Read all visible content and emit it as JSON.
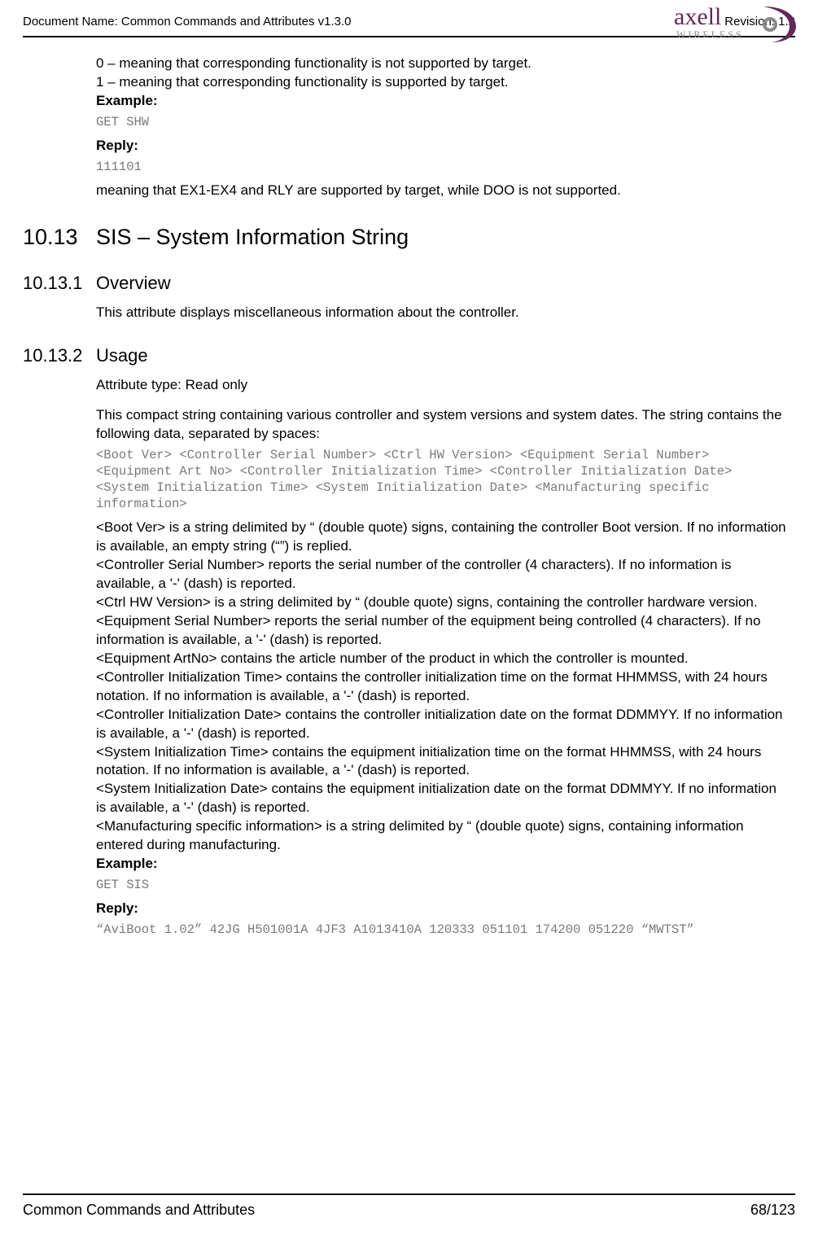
{
  "header": {
    "doc_name_label": "Document Name: Common Commands and Attributes v1.3.0",
    "revision_label": "Revision: 1.2",
    "logo_text_main": "axell",
    "logo_text_sub": "WIRELESS"
  },
  "intro": {
    "line0": "0 – meaning that corresponding functionality is not supported by target.",
    "line1": "1 – meaning that corresponding functionality is supported by target.",
    "example_hdr": "Example:",
    "example_code": "GET SHW",
    "reply_hdr": "Reply:",
    "reply_code": "111101",
    "meaning": "meaning that EX1-EX4 and RLY are supported by target, while DOO is not supported."
  },
  "s1013": {
    "num": "10.13",
    "title": "SIS – System Information String"
  },
  "s10131": {
    "num": "10.13.1",
    "title": "Overview",
    "body": "This attribute displays miscellaneous information about the controller."
  },
  "s10132": {
    "num": "10.13.2",
    "title": "Usage",
    "attr_type": "Attribute type: Read only",
    "intro": "This compact string containing various controller and system versions and system dates. The string contains the following data, separated by spaces:",
    "format": "<Boot Ver> <Controller Serial Number> <Ctrl HW Version> <Equipment Serial Number> <Equipment Art No> <Controller Initialization Time> <Controller Initialization Date> <System Initialization Time> <System Initialization Date>  <Manufacturing specific information>",
    "p_boot": "<Boot Ver> is a string delimited by “ (double quote) signs, containing the controller Boot version. If no information is available, an empty string (“”) is replied.",
    "p_csn": "<Controller Serial Number> reports the serial number of the controller (4 characters). If no information is available, a '-' (dash) is reported.",
    "p_chw": "<Ctrl HW Version> is a string delimited by “ (double quote) signs, containing the controller hardware version.",
    "p_esn": "<Equipment Serial Number> reports the serial number of the equipment being controlled (4 characters). If no information is available, a '-' (dash) is reported.",
    "p_art": "<Equipment ArtNo> contains the article number of the product in which the controller is mounted.",
    "p_cit": "<Controller Initialization Time> contains the controller initialization time on the format HHMMSS, with 24 hours notation. If no information is available, a '-' (dash) is reported.",
    "p_cid": "<Controller Initialization Date> contains the controller initialization date on the format DDMMYY. If no information is available, a '-' (dash) is reported.",
    "p_sit": "<System Initialization Time> contains the equipment  initialization time on the format HHMMSS, with 24 hours notation. If no information is available, a '-' (dash) is reported.",
    "p_sid": "<System Initialization Date> contains the equipment initialization date on the format DDMMYY. If no information is available, a '-' (dash) is reported.",
    "p_manu": "<Manufacturing specific information> is a string delimited by “ (double quote) signs, containing information entered during manufacturing.",
    "example_hdr": "Example:",
    "example_code": "GET SIS",
    "reply_hdr": "Reply:",
    "reply_code": "“AviBoot 1.02” 42JG H501001A 4JF3 A1013410A 120333 051101 174200 051220 “MWTST”"
  },
  "footer": {
    "left": "Common Commands and Attributes",
    "right": "68/123"
  }
}
